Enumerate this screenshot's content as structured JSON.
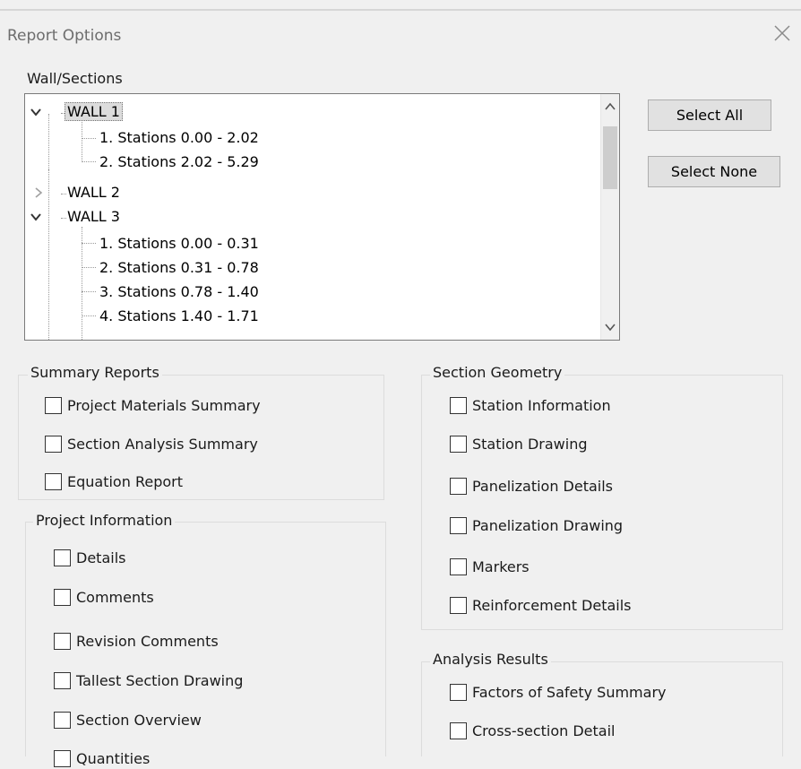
{
  "window": {
    "title": "Report Options",
    "close_label": "close"
  },
  "wall_sections": {
    "label": "Wall/Sections",
    "tree": {
      "wall1": {
        "label": "WALL 1",
        "sections": [
          "1. Stations 0.00 - 2.02",
          "2. Stations 2.02 - 5.29"
        ]
      },
      "wall2": {
        "label": "WALL 2"
      },
      "wall3": {
        "label": "WALL 3",
        "sections": [
          "1. Stations 0.00 - 0.31",
          "2. Stations 0.31 - 0.78",
          "3. Stations 0.78 - 1.40",
          "4. Stations 1.40 - 1.71"
        ]
      }
    }
  },
  "buttons": {
    "select_all": "Select All",
    "select_none": "Select None"
  },
  "summary_reports": {
    "title": "Summary Reports",
    "items": [
      "Project Materials Summary",
      "Section Analysis Summary",
      "Equation Report"
    ]
  },
  "project_information": {
    "title": "Project Information",
    "items": [
      "Details",
      "Comments",
      "Revision Comments",
      "Tallest Section Drawing",
      "Section Overview",
      "Quantities"
    ]
  },
  "section_geometry": {
    "title": "Section Geometry",
    "items": [
      "Station Information",
      "Station Drawing",
      "Panelization Details",
      "Panelization Drawing",
      "Markers",
      "Reinforcement Details"
    ]
  },
  "analysis_results": {
    "title": "Analysis Results",
    "items": [
      "Factors of Safety Summary",
      "Cross-section Detail"
    ]
  }
}
